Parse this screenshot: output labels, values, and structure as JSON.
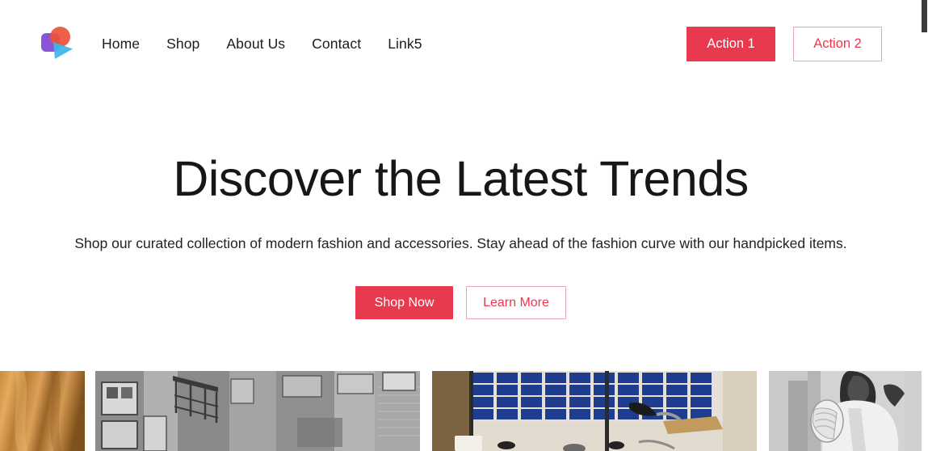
{
  "theme": {
    "accent": "#e8394f",
    "accent_outline_border": "#e8a7b2",
    "text": "#1c1c1c",
    "background": "#ffffff",
    "scrollbar_thumb": "#3b3b3b"
  },
  "header": {
    "logo": {
      "name": "brand-logo",
      "shapes": [
        "purple-rounded-square",
        "orange-circle",
        "cyan-play-triangle"
      ],
      "colors": {
        "square": "#8b53d6",
        "circle": "#ee5338",
        "triangle": "#3fb6e8"
      }
    },
    "nav": [
      {
        "label": "Home"
      },
      {
        "label": "Shop"
      },
      {
        "label": "About Us"
      },
      {
        "label": "Contact"
      },
      {
        "label": "Link5"
      }
    ],
    "actions": [
      {
        "label": "Action 1",
        "style": "solid"
      },
      {
        "label": "Action 2",
        "style": "outline"
      }
    ]
  },
  "hero": {
    "title": "Discover the Latest Trends",
    "subtitle": "Shop our curated collection of modern fashion and accessories. Stay ahead of the fashion curve with our handpicked items.",
    "cta": [
      {
        "label": "Shop Now",
        "style": "solid"
      },
      {
        "label": "Learn More",
        "style": "outline"
      }
    ]
  },
  "gallery": {
    "items": [
      {
        "name": "gallery-image-1",
        "description": "warm tan draped fabric texture, cropped at left edge",
        "tone": "sepia"
      },
      {
        "name": "gallery-image-2",
        "description": "grayscale urban street with stone building facade and fire escape",
        "tone": "grayscale"
      },
      {
        "name": "gallery-image-3",
        "description": "retail interior with wall of blue shoe boxes on shelving",
        "tone": "color"
      },
      {
        "name": "gallery-image-4",
        "description": "grayscale person in white lab coat holding a rolled item",
        "tone": "grayscale"
      }
    ]
  },
  "scrollbar": {
    "name": "page-scrollbar",
    "position": "top"
  }
}
